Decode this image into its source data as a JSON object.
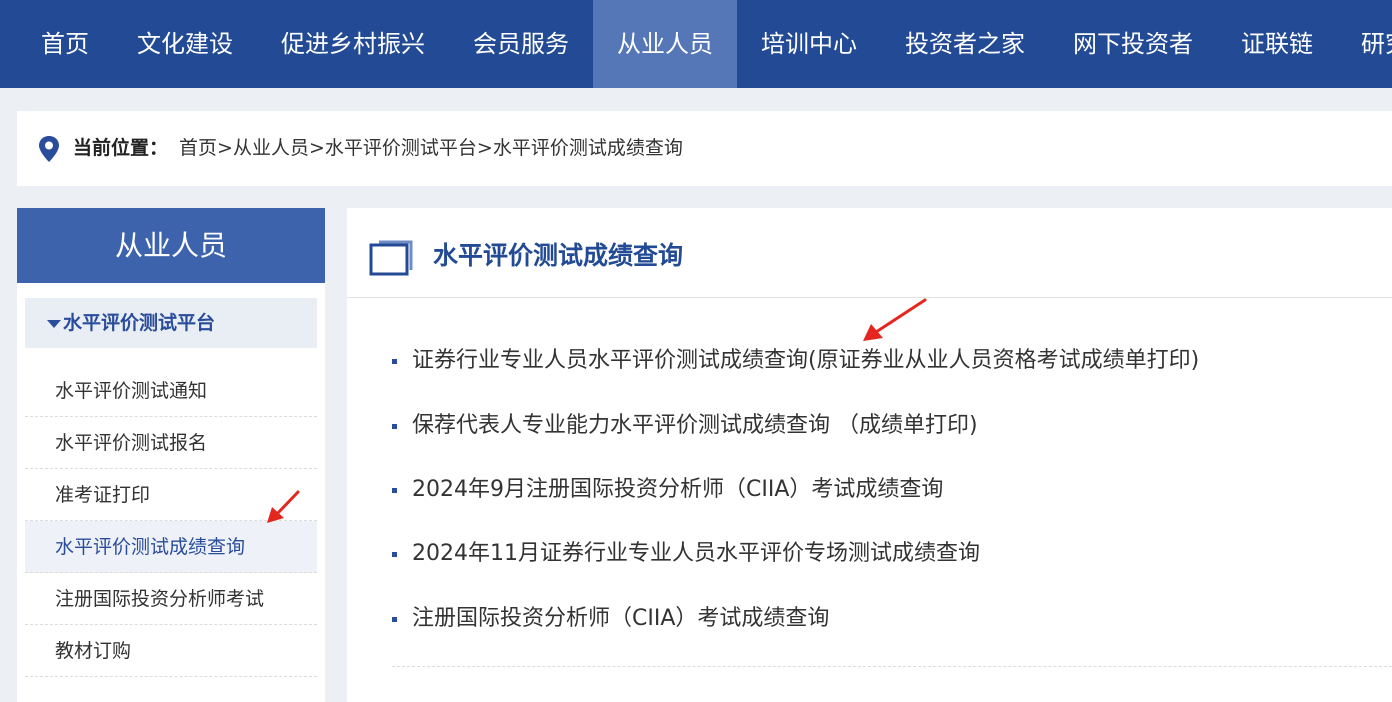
{
  "topnav": {
    "items": [
      "首页",
      "文化建设",
      "促进乡村振兴",
      "会员服务",
      "从业人员",
      "培训中心",
      "投资者之家",
      "网下投资者",
      "证联链",
      "研究"
    ],
    "active_index": 4
  },
  "breadcrumb": {
    "label": "当前位置：",
    "path": [
      "首页",
      "从业人员",
      "水平评价测试平台",
      "水平评价测试成绩查询"
    ],
    "separator": ">"
  },
  "sidebar": {
    "title": "从业人员",
    "group_label": "水平评价测试平台",
    "items": [
      "水平评价测试通知",
      "水平评价测试报名",
      "准考证打印",
      "水平评价测试成绩查询",
      "注册国际投资分析师考试",
      "教材订购"
    ],
    "active_index": 3
  },
  "main": {
    "title": "水平评价测试成绩查询",
    "links": [
      "证券行业专业人员水平评价测试成绩查询(原证券业从业人员资格考试成绩单打印)",
      "保荐代表人专业能力水平评价测试成绩查询 （成绩单打印)",
      "2024年9月注册国际投资分析师（CIIA）考试成绩查询",
      "2024年11月证券行业专业人员水平评价专场测试成绩查询",
      "注册国际投资分析师（CIIA）考试成绩查询"
    ]
  },
  "colors": {
    "nav_bg": "#234b95",
    "nav_active": "#5577b7",
    "sidebar_head": "#3e63ad",
    "accent_text": "#2a4d9b",
    "arrow": "#e5261f"
  },
  "icons": [
    "location-pin-icon",
    "square-frame-icon",
    "triangle-down-icon",
    "square-bullet-icon",
    "red-arrow-icon"
  ]
}
